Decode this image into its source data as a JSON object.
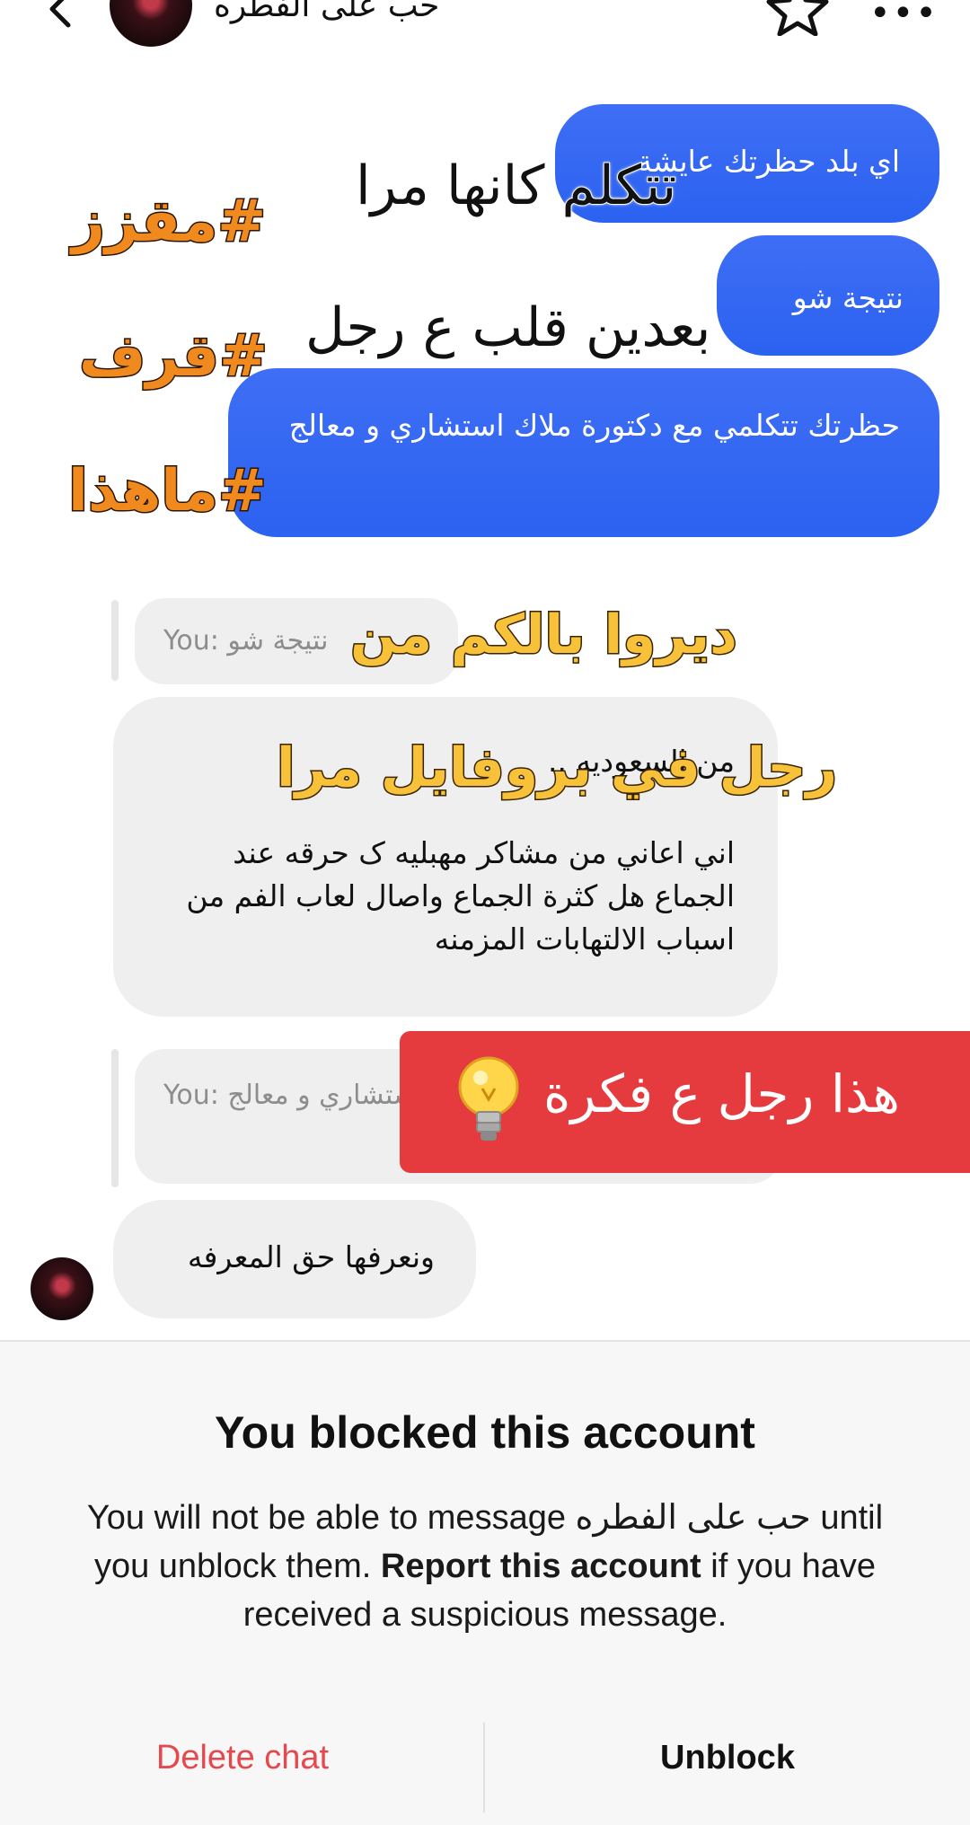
{
  "header": {
    "title": "حب على الفطره"
  },
  "messages": {
    "outgoing": [
      "اي بلد حظرتك عايشة",
      "نتيجة شو",
      "حظرتك تتكلمي مع دكتورة ملاك  استشاري و معالج"
    ],
    "reply_quote_1": "You: نتيجة شو",
    "incoming_1_line1": "من السعوديه ..",
    "incoming_1_body": "اني اعاني من مشاكر مهبليه ک حرقه عند الجماع هل كثرة الجماع واصال لعاب الفم من اسباب الالتهابات المزمنه",
    "reply_quote_2": "You: ك  استشاري و معالج",
    "incoming_2": "ونعرفها حق المعرفه"
  },
  "overlays": {
    "caption_1": "تتكلم كانها مرا",
    "caption_2": "بعدين قلب ع رجل",
    "hashtags": [
      "#مقزز",
      "#قرف",
      "#ماهذا"
    ],
    "caption_3": "ديروا بالكم من",
    "caption_4": "رجل في بروفايل مرا",
    "banner": "هذا رجل ع فكرة"
  },
  "blocked": {
    "title": "You blocked this account",
    "desc_1": "You will not be able to message ",
    "desc_name": "حب على الفطره",
    "desc_2": " until you unblock them. ",
    "desc_bold": "Report this account",
    "desc_3": " if you have received a suspicious message.",
    "delete_label": "Delete chat",
    "unblock_label": "Unblock"
  },
  "colors": {
    "bubble_out": "#2b62f0",
    "bubble_in": "#efefef",
    "delete": "#e5484d",
    "banner": "#e53b3e",
    "hashtag": "#f08a1f",
    "caption_yellow": "#f7c23a"
  },
  "icons": [
    "back-icon",
    "star-icon",
    "more-icon",
    "bulb-icon"
  ]
}
